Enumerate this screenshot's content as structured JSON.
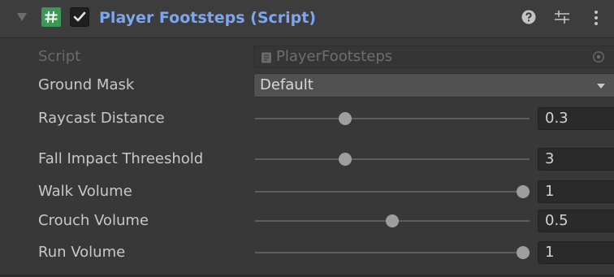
{
  "component": {
    "title": "Player Footsteps (Script)",
    "enabled": true,
    "icons": {
      "foldout": "foldout-expanded-triangle",
      "script": "csharp-script-hash",
      "help": "help-icon",
      "presets": "presets-sliders-icon",
      "menu": "kebab-menu-icon"
    },
    "colors": {
      "title": "#7ca7ee",
      "script_icon": "#3a9a53",
      "background": "#383838"
    }
  },
  "fields": {
    "script": {
      "label": "Script",
      "value": "PlayerFootsteps"
    },
    "ground_mask": {
      "label": "Ground Mask",
      "value": "Default"
    }
  },
  "sliders": [
    {
      "key": "raycast_distance",
      "label": "Raycast Distance",
      "value_text": "0.3",
      "fraction": 0.32
    },
    {
      "key": "fall_impact_threeshold",
      "label": "Fall Impact Threeshold",
      "value_text": "3",
      "fraction": 0.32
    },
    {
      "key": "walk_volume",
      "label": "Walk Volume",
      "value_text": "1",
      "fraction": 1.0
    },
    {
      "key": "crouch_volume",
      "label": "Crouch Volume",
      "value_text": "0.5",
      "fraction": 0.5
    },
    {
      "key": "run_volume",
      "label": "Run Volume",
      "value_text": "1",
      "fraction": 1.0
    }
  ]
}
